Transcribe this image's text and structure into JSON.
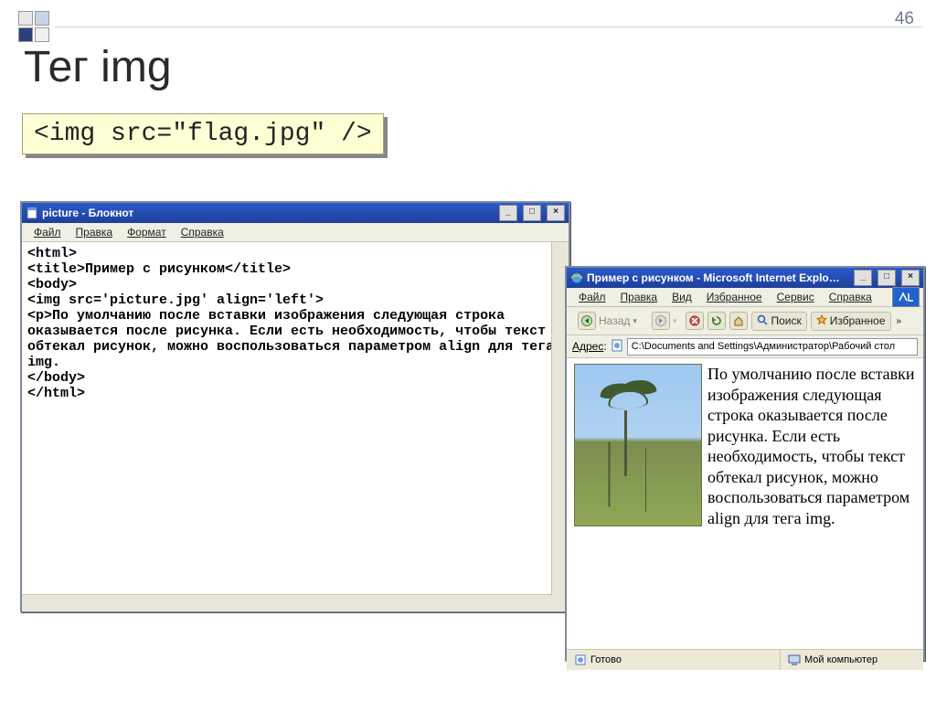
{
  "slide": {
    "page_number": "46",
    "title": "Тег img",
    "code": "<img src=\"flag.jpg\" />"
  },
  "notepad": {
    "title": "picture - Блокнот",
    "menu": {
      "file": "Файл",
      "edit": "Правка",
      "format": "Формат",
      "help": "Справка"
    },
    "content": "<html>\n<title>Пример с рисунком</title>\n<body>\n<img src='picture.jpg' align='left'>\n<p>По умолчанию после вставки изображения следующая строка оказывается после рисунка. Если есть необходимость, чтобы текст обтекал рисунок, можно воспользоваться параметром align для тега img.\n</body>\n</html>"
  },
  "ie": {
    "title": "Пример с рисунком - Microsoft Internet Explorer",
    "menu": {
      "file": "Файл",
      "edit": "Правка",
      "view": "Вид",
      "favorites": "Избранное",
      "tools": "Сервис",
      "help": "Справка"
    },
    "toolbar": {
      "back": "Назад",
      "search": "Поиск",
      "favorites": "Избранное"
    },
    "address": {
      "label": "Адрес",
      "value": "C:\\Documents and Settings\\Администратор\\Рабочий стол"
    },
    "page_text": "По умолчанию после вставки изображения следующая строка оказывается после рисунка. Если есть необходимость, чтобы текст обтекал рисунок, можно воспользоваться параметром align для тега img.",
    "status": {
      "ready": "Готово",
      "zone": "Мой компьютер"
    }
  }
}
